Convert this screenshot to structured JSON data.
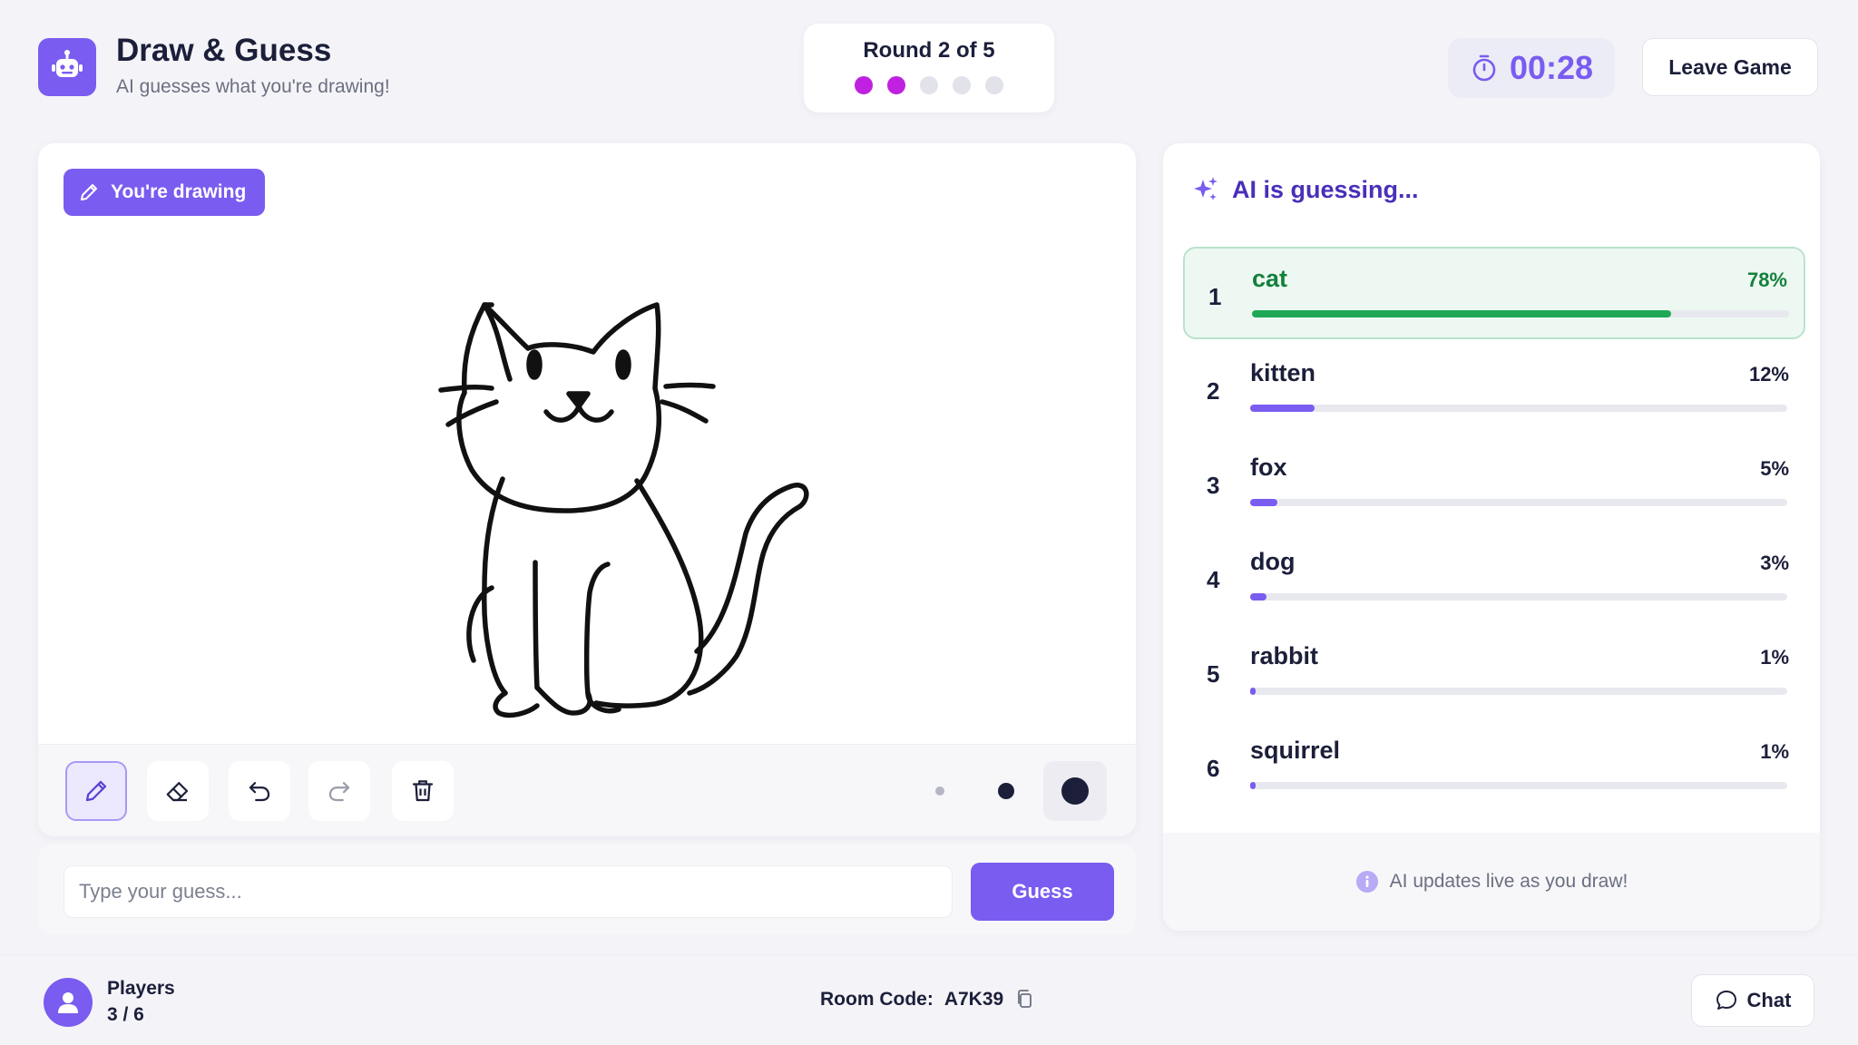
{
  "header": {
    "title": "Draw & Guess",
    "subtitle": "AI guesses what you're drawing!",
    "round_label": "Round 2 of 5",
    "round_current": 2,
    "round_total": 5,
    "timer": "00:28",
    "leave_label": "Leave Game"
  },
  "canvas": {
    "badge_label": "You're drawing",
    "tools": [
      "pencil-icon",
      "eraser-icon",
      "undo-icon",
      "redo-icon",
      "trash-icon"
    ],
    "brush_sizes": [
      "small",
      "medium",
      "large"
    ],
    "selected_brush": "large"
  },
  "guess": {
    "placeholder": "Type your guess...",
    "button_label": "Guess"
  },
  "ai": {
    "title": "AI is guessing...",
    "footer": "AI updates live as you draw!",
    "guesses": [
      {
        "rank": "1",
        "word": "cat",
        "pct_label": "78%",
        "value": 78
      },
      {
        "rank": "2",
        "word": "kitten",
        "pct_label": "12%",
        "value": 12
      },
      {
        "rank": "3",
        "word": "fox",
        "pct_label": "5%",
        "value": 5
      },
      {
        "rank": "4",
        "word": "dog",
        "pct_label": "3%",
        "value": 3
      },
      {
        "rank": "5",
        "word": "rabbit",
        "pct_label": "1%",
        "value": 1
      },
      {
        "rank": "6",
        "word": "squirrel",
        "pct_label": "1%",
        "value": 1
      }
    ]
  },
  "footer": {
    "players_label": "Players",
    "players_count": "3 / 6",
    "room_label": "Room Code:",
    "room_code": "A7K39",
    "chat_label": "Chat"
  },
  "colors": {
    "accent": "#7a5cf0",
    "round_dot_active": "#c021e0",
    "top_guess": "#1fa957"
  }
}
